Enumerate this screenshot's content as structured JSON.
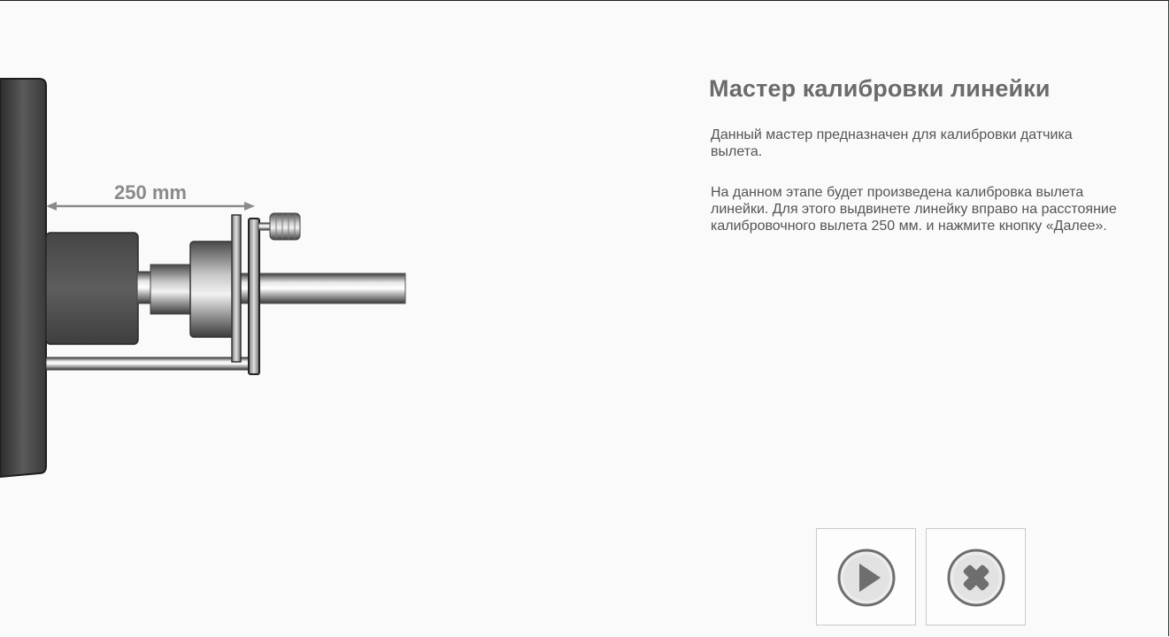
{
  "wizard": {
    "title": "Мастер калибровки линейки",
    "paragraph1": "Данный мастер предназначен для калибровки датчика вылета.",
    "paragraph2": "На данном этапе будет произведена калибровка вылета линейки. Для этого выдвинете линейку вправо на расстояние калибровочного вылета 250 мм. и нажмите кнопку «Далее»."
  },
  "illustration": {
    "distance_label": "250 mm"
  },
  "buttons": {
    "next_icon": "play-icon",
    "cancel_icon": "close-icon"
  },
  "colors": {
    "background": "#fafafa",
    "title": "#6b6b6b",
    "text": "#555555",
    "button_border": "#c9c9c9",
    "icon_fill": "#6e6e6e"
  }
}
